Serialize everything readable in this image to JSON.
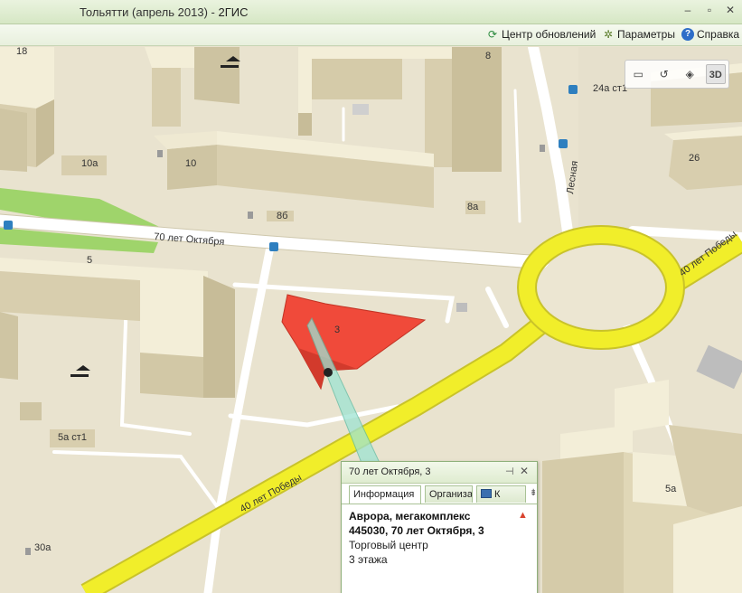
{
  "window": {
    "title_city": "Тольятти (апрель 2013)",
    "title_sep": " - ",
    "title_app": "2ГИС",
    "minimize": "‒",
    "maximize": "▫",
    "close": "✕"
  },
  "toolbar": {
    "update_center": "Центр обновлений",
    "settings": "Параметры",
    "help": "Справка",
    "update_icon": "refresh-icon",
    "settings_icon": "gear-icon",
    "help_icon": "help-icon"
  },
  "map_controls": {
    "ruler_icon": "ruler-icon",
    "route_icon": "route-icon",
    "layers_icon": "layers-icon",
    "mode_3d": "3D"
  },
  "map": {
    "building_labels": {
      "b18": "18",
      "b8": "8",
      "b24a": "24а ст1",
      "b10a": "10а",
      "b10": "10",
      "b26": "26",
      "b8b": "8б",
      "b8a": "8а",
      "b5": "5",
      "b3": "3",
      "b5a_st1": "5а ст1",
      "b5a": "5а",
      "b30a": "30а"
    },
    "streets": {
      "oct70": "70 лет Октября",
      "pobedy_left": "40 лет Победы",
      "pobedy_right": "40 лет Победы",
      "lesnaya": "Лесная"
    },
    "colors": {
      "ground": "#e9e3cf",
      "highlight": "#f04a3a",
      "roundabout": "#f1ee2a",
      "park": "#9fd46b"
    }
  },
  "popup": {
    "address": "70 лет Октября, 3",
    "pin_icon": "pin-icon",
    "close_icon": "close-icon",
    "tab_info": "Информация",
    "tab_org": "Организации",
    "tab_k": "К",
    "tab_more": "⇟",
    "name": "Аврора, мегакомплекс",
    "postal_address": "445030, 70 лет Октября, 3",
    "category": "Торговый центр",
    "floors": "3 этажа"
  }
}
